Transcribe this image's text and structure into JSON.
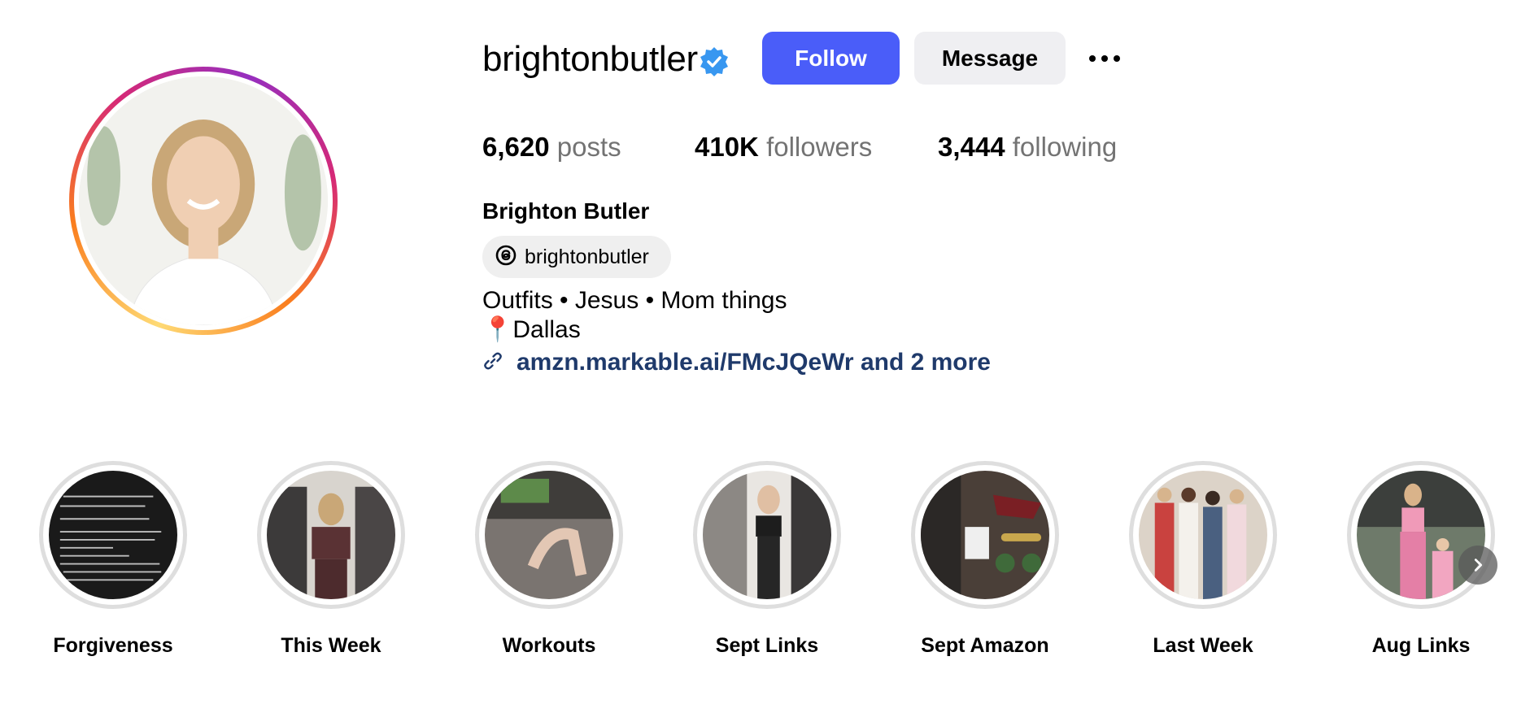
{
  "profile": {
    "username": "brightonbutler",
    "verified": true,
    "accent_color": "#4a5df9",
    "follow_label": "Follow",
    "message_label": "Message",
    "more_icon": "more-horizontal-icon"
  },
  "stats": {
    "posts_count": "6,620",
    "posts_label": "posts",
    "followers_count": "410K",
    "followers_label": "followers",
    "following_count": "3,444",
    "following_label": "following"
  },
  "bio": {
    "full_name": "Brighton Butler",
    "threads_handle": "brightonbutler",
    "line1": "Outfits • Jesus • Mom things",
    "location_icon": "📍",
    "location": "Dallas",
    "link_text": "amzn.markable.ai/FMcJQeWr and 2 more",
    "link_color": "#1f3a6b"
  },
  "highlights": [
    {
      "label": "Forgiveness"
    },
    {
      "label": "This Week"
    },
    {
      "label": "Workouts"
    },
    {
      "label": "Sept Links"
    },
    {
      "label": "Sept Amazon"
    },
    {
      "label": "Last Week"
    },
    {
      "label": "Aug Links"
    }
  ]
}
